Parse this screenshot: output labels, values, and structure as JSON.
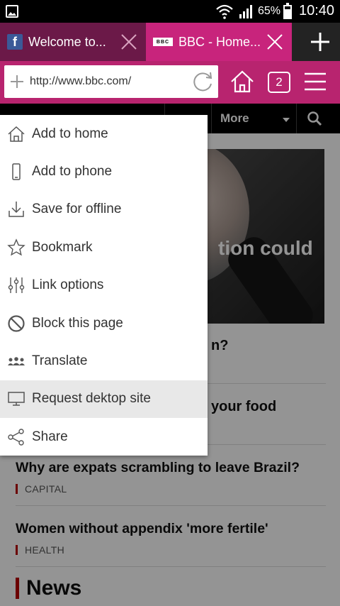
{
  "status_bar": {
    "battery_percent": "65%",
    "clock": "10:40",
    "icons": [
      "image-notification-icon",
      "wifi-icon",
      "signal-icon",
      "battery-icon"
    ]
  },
  "tabs": [
    {
      "title": "Welcome to...",
      "favicon": "facebook-favicon",
      "active": false
    },
    {
      "title": "BBC - Home...",
      "favicon_text": "BBC",
      "active": true
    }
  ],
  "address_bar": {
    "url": "http://www.bbc.com/",
    "tab_count": "2"
  },
  "colors": {
    "tab_active": "#c8247c",
    "tab_inactive": "#6b1948",
    "address_bar": "#b8246f",
    "bbc_red": "#b80000"
  },
  "page": {
    "nav_more": "More",
    "hero_caption_fragment": "tion could",
    "story_fragments": [
      "n?",
      "your food"
    ],
    "stories": [
      {
        "headline": "Why are expats scrambling to leave Brazil?",
        "tag": "CAPITAL"
      },
      {
        "headline": "Women without appendix 'more fertile'",
        "tag": "HEALTH"
      }
    ],
    "section_heading": "News"
  },
  "menu": {
    "items": [
      {
        "label": "Add to home",
        "icon": "home-icon"
      },
      {
        "label": "Add to phone",
        "icon": "phone-icon"
      },
      {
        "label": "Save for offline",
        "icon": "download-icon"
      },
      {
        "label": "Bookmark",
        "icon": "star-icon"
      },
      {
        "label": "Link options",
        "icon": "sliders-icon"
      },
      {
        "label": "Block this page",
        "icon": "block-icon"
      },
      {
        "label": "Translate",
        "icon": "translate-icon"
      },
      {
        "label": "Request dektop site",
        "icon": "desktop-icon",
        "highlighted": true
      },
      {
        "label": "Share",
        "icon": "share-icon"
      }
    ]
  }
}
